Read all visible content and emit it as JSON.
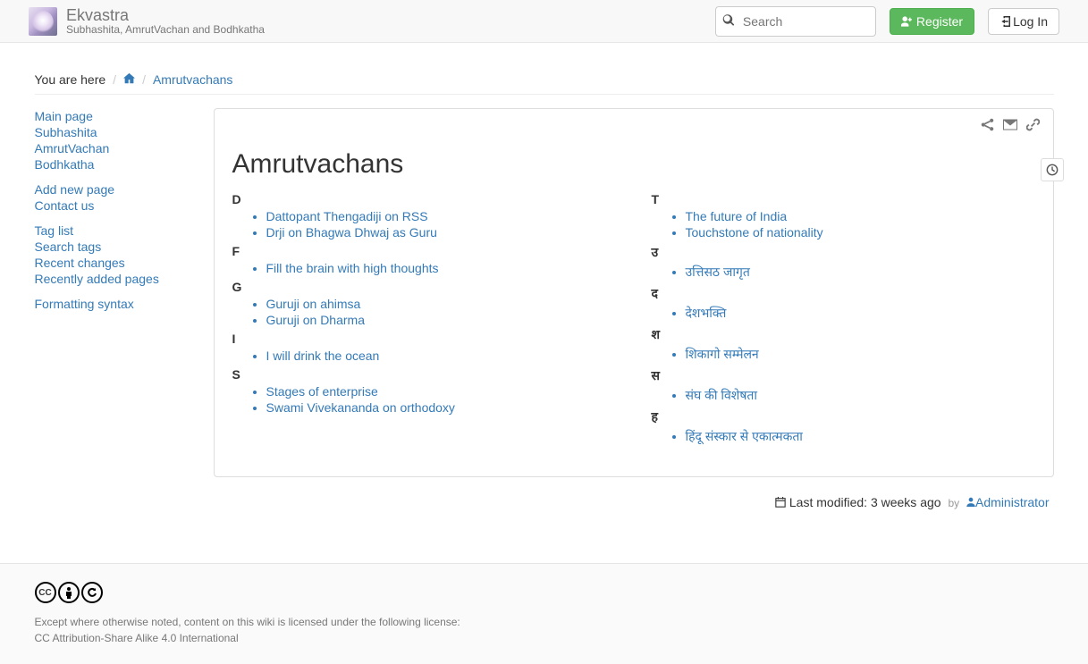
{
  "brand": {
    "title": "Ekvastra",
    "subtitle": "Subhashita, AmrutVachan and Bodhkatha"
  },
  "search": {
    "placeholder": "Search"
  },
  "buttons": {
    "register": "Register",
    "login": "Log In"
  },
  "breadcrumb": {
    "label": "You are here",
    "current": "Amrutvachans"
  },
  "sidebar": {
    "g1": [
      "Main page",
      "Subhashita",
      "AmrutVachan",
      "Bodhkatha"
    ],
    "g2": [
      "Add new page",
      "Contact us"
    ],
    "g3": [
      "Tag list",
      "Search tags",
      "Recent changes",
      "Recently added pages"
    ],
    "g4": [
      "Formatting syntax"
    ]
  },
  "page": {
    "title": "Amrutvachans",
    "left": [
      {
        "letter": "D",
        "items": [
          "Dattopant Thengadiji on RSS",
          "Drji on Bhagwa Dhwaj as Guru"
        ]
      },
      {
        "letter": "F",
        "items": [
          "Fill the brain with high thoughts"
        ]
      },
      {
        "letter": "G",
        "items": [
          "Guruji on ahimsa",
          "Guruji on Dharma"
        ]
      },
      {
        "letter": "I",
        "items": [
          "I will drink the ocean"
        ]
      },
      {
        "letter": "S",
        "items": [
          "Stages of enterprise",
          "Swami Vivekananda on orthodoxy"
        ]
      }
    ],
    "right": [
      {
        "letter": "T",
        "items": [
          "The future of India",
          "Touchstone of nationality"
        ]
      },
      {
        "letter": "उ",
        "items": [
          "उत्तिसठ जागृत"
        ]
      },
      {
        "letter": "द",
        "items": [
          "देशभक्ति"
        ]
      },
      {
        "letter": "श",
        "items": [
          "शिकागो सम्मेलन"
        ]
      },
      {
        "letter": "स",
        "items": [
          "संघ की विशेषता"
        ]
      },
      {
        "letter": "ह",
        "items": [
          "हिंदू संस्कार से एकात्मकता"
        ]
      }
    ]
  },
  "meta": {
    "modified_label": "Last modified:",
    "modified_value": "3 weeks ago",
    "by": "by",
    "author": "Administrator"
  },
  "footer": {
    "line1": "Except where otherwise noted, content on this wiki is licensed under the following license:",
    "line2": "CC Attribution-Share Alike 4.0 International"
  }
}
